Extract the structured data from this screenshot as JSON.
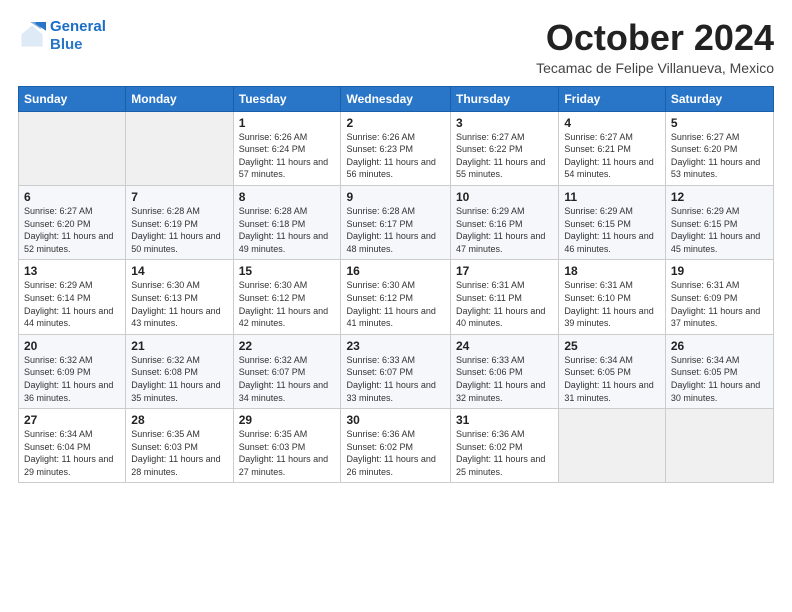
{
  "logo": {
    "line1": "General",
    "line2": "Blue"
  },
  "title": "October 2024",
  "location": "Tecamac de Felipe Villanueva, Mexico",
  "days_of_week": [
    "Sunday",
    "Monday",
    "Tuesday",
    "Wednesday",
    "Thursday",
    "Friday",
    "Saturday"
  ],
  "weeks": [
    [
      {
        "num": "",
        "info": ""
      },
      {
        "num": "",
        "info": ""
      },
      {
        "num": "1",
        "info": "Sunrise: 6:26 AM\nSunset: 6:24 PM\nDaylight: 11 hours and 57 minutes."
      },
      {
        "num": "2",
        "info": "Sunrise: 6:26 AM\nSunset: 6:23 PM\nDaylight: 11 hours and 56 minutes."
      },
      {
        "num": "3",
        "info": "Sunrise: 6:27 AM\nSunset: 6:22 PM\nDaylight: 11 hours and 55 minutes."
      },
      {
        "num": "4",
        "info": "Sunrise: 6:27 AM\nSunset: 6:21 PM\nDaylight: 11 hours and 54 minutes."
      },
      {
        "num": "5",
        "info": "Sunrise: 6:27 AM\nSunset: 6:20 PM\nDaylight: 11 hours and 53 minutes."
      }
    ],
    [
      {
        "num": "6",
        "info": "Sunrise: 6:27 AM\nSunset: 6:20 PM\nDaylight: 11 hours and 52 minutes."
      },
      {
        "num": "7",
        "info": "Sunrise: 6:28 AM\nSunset: 6:19 PM\nDaylight: 11 hours and 50 minutes."
      },
      {
        "num": "8",
        "info": "Sunrise: 6:28 AM\nSunset: 6:18 PM\nDaylight: 11 hours and 49 minutes."
      },
      {
        "num": "9",
        "info": "Sunrise: 6:28 AM\nSunset: 6:17 PM\nDaylight: 11 hours and 48 minutes."
      },
      {
        "num": "10",
        "info": "Sunrise: 6:29 AM\nSunset: 6:16 PM\nDaylight: 11 hours and 47 minutes."
      },
      {
        "num": "11",
        "info": "Sunrise: 6:29 AM\nSunset: 6:15 PM\nDaylight: 11 hours and 46 minutes."
      },
      {
        "num": "12",
        "info": "Sunrise: 6:29 AM\nSunset: 6:15 PM\nDaylight: 11 hours and 45 minutes."
      }
    ],
    [
      {
        "num": "13",
        "info": "Sunrise: 6:29 AM\nSunset: 6:14 PM\nDaylight: 11 hours and 44 minutes."
      },
      {
        "num": "14",
        "info": "Sunrise: 6:30 AM\nSunset: 6:13 PM\nDaylight: 11 hours and 43 minutes."
      },
      {
        "num": "15",
        "info": "Sunrise: 6:30 AM\nSunset: 6:12 PM\nDaylight: 11 hours and 42 minutes."
      },
      {
        "num": "16",
        "info": "Sunrise: 6:30 AM\nSunset: 6:12 PM\nDaylight: 11 hours and 41 minutes."
      },
      {
        "num": "17",
        "info": "Sunrise: 6:31 AM\nSunset: 6:11 PM\nDaylight: 11 hours and 40 minutes."
      },
      {
        "num": "18",
        "info": "Sunrise: 6:31 AM\nSunset: 6:10 PM\nDaylight: 11 hours and 39 minutes."
      },
      {
        "num": "19",
        "info": "Sunrise: 6:31 AM\nSunset: 6:09 PM\nDaylight: 11 hours and 37 minutes."
      }
    ],
    [
      {
        "num": "20",
        "info": "Sunrise: 6:32 AM\nSunset: 6:09 PM\nDaylight: 11 hours and 36 minutes."
      },
      {
        "num": "21",
        "info": "Sunrise: 6:32 AM\nSunset: 6:08 PM\nDaylight: 11 hours and 35 minutes."
      },
      {
        "num": "22",
        "info": "Sunrise: 6:32 AM\nSunset: 6:07 PM\nDaylight: 11 hours and 34 minutes."
      },
      {
        "num": "23",
        "info": "Sunrise: 6:33 AM\nSunset: 6:07 PM\nDaylight: 11 hours and 33 minutes."
      },
      {
        "num": "24",
        "info": "Sunrise: 6:33 AM\nSunset: 6:06 PM\nDaylight: 11 hours and 32 minutes."
      },
      {
        "num": "25",
        "info": "Sunrise: 6:34 AM\nSunset: 6:05 PM\nDaylight: 11 hours and 31 minutes."
      },
      {
        "num": "26",
        "info": "Sunrise: 6:34 AM\nSunset: 6:05 PM\nDaylight: 11 hours and 30 minutes."
      }
    ],
    [
      {
        "num": "27",
        "info": "Sunrise: 6:34 AM\nSunset: 6:04 PM\nDaylight: 11 hours and 29 minutes."
      },
      {
        "num": "28",
        "info": "Sunrise: 6:35 AM\nSunset: 6:03 PM\nDaylight: 11 hours and 28 minutes."
      },
      {
        "num": "29",
        "info": "Sunrise: 6:35 AM\nSunset: 6:03 PM\nDaylight: 11 hours and 27 minutes."
      },
      {
        "num": "30",
        "info": "Sunrise: 6:36 AM\nSunset: 6:02 PM\nDaylight: 11 hours and 26 minutes."
      },
      {
        "num": "31",
        "info": "Sunrise: 6:36 AM\nSunset: 6:02 PM\nDaylight: 11 hours and 25 minutes."
      },
      {
        "num": "",
        "info": ""
      },
      {
        "num": "",
        "info": ""
      }
    ]
  ]
}
